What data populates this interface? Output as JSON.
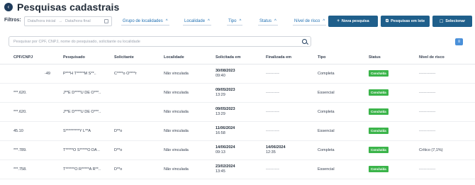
{
  "header": {
    "title": "Pesquisas cadastrais",
    "back_glyph": "‹"
  },
  "filters": {
    "label": "Filtros:",
    "date_start_placeholder": "Data/hora inicial",
    "date_end_placeholder": "Data/hora final",
    "dropdowns": [
      "Grupo de localidades",
      "Localidade",
      "Tipo",
      "Status",
      "Nível de risco"
    ]
  },
  "actions": {
    "new_search": "Nova pesquisa",
    "batch_search": "Pesquisas em lote",
    "select": "Selecionar"
  },
  "search": {
    "placeholder": "Pesquisar por CPF, CNPJ, nome do pesquisado, solicitante ou localidade"
  },
  "table": {
    "columns": [
      "CPF/CNPJ",
      "Pesquisado",
      "Solicitante",
      "Localidade",
      "Solicitada em",
      "Finalizada em",
      "Tipo",
      "Status",
      "Nível de risco"
    ],
    "rows": [
      {
        "doc": "-49",
        "person": "P***H T*****M S**..",
        "requester": "C****o O****r",
        "locality": "Não vinculada",
        "requested_date": "30/08/2023",
        "requested_time": "09:40",
        "finished_date": "---------",
        "finished_time": "",
        "type": "Completa",
        "status": "Concluída",
        "risk": "-----------"
      },
      {
        "doc": "***.620.",
        "person": "J**E D****U DE O***..",
        "requester": "",
        "locality": "Não vinculada",
        "requested_date": "09/05/2023",
        "requested_time": "13:29",
        "finished_date": "---------",
        "finished_time": "",
        "type": "Essencial",
        "status": "Concluída",
        "risk": "-----------"
      },
      {
        "doc": "***.620.",
        "person": "J**E D****U DE O***..",
        "requester": "",
        "locality": "Não vinculada",
        "requested_date": "09/05/2023",
        "requested_time": "13:29",
        "finished_date": "---------",
        "finished_time": "",
        "type": "Completa",
        "status": "Concluída",
        "risk": "-----------"
      },
      {
        "doc": "45.10",
        "person": "S*********Y L**A",
        "requester": "D**o",
        "locality": "Não vinculada",
        "requested_date": "11/06/2024",
        "requested_time": "16:58",
        "finished_date": "---------",
        "finished_time": "",
        "type": "Essencial",
        "status": "Concluída",
        "risk": "-----------"
      },
      {
        "doc": "***.789.",
        "person": "T*****O S*****O DA ..",
        "requester": "D**o",
        "locality": "Não vinculada",
        "requested_date": "14/06/2024",
        "requested_time": "09:13",
        "finished_date": "14/06/2024",
        "finished_time": "12:35",
        "type": "Completa",
        "status": "Concluída",
        "risk": "Crítico (7,1%)"
      },
      {
        "doc": "***.758.",
        "person": "T******O R*****A R**..",
        "requester": "D**o",
        "locality": "Não vinculada",
        "requested_date": "23/02/2024",
        "requested_time": "13:45",
        "finished_date": "---------",
        "finished_time": "",
        "type": "Essencial",
        "status": "Concluída",
        "risk": "-----------"
      }
    ]
  },
  "colors": {
    "primary": "#1f5f8b",
    "success": "#3bb44a",
    "link": "#1f6fb2"
  }
}
